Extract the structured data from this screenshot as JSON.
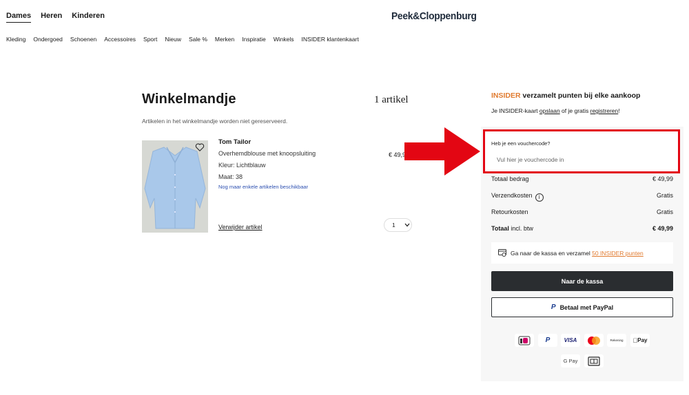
{
  "header": {
    "genders": [
      {
        "label": "Dames",
        "active": true
      },
      {
        "label": "Heren",
        "active": false
      },
      {
        "label": "Kinderen",
        "active": false
      }
    ],
    "logo": "Peek&Cloppenburg",
    "categories": [
      "Kleding",
      "Ondergoed",
      "Schoenen",
      "Accessoires",
      "Sport",
      "Nieuw",
      "Sale %",
      "Merken",
      "Inspiratie",
      "Winkels",
      "INSIDER klantenkaart"
    ]
  },
  "cart": {
    "title": "Winkelmandje",
    "count": "1 artikel",
    "note": "Artikelen in het winkelmandje worden niet gereserveerd."
  },
  "product": {
    "brand": "Tom Tailor",
    "description": "Overhemdblouse met knoopsluiting",
    "color": "Kleur: Lichtblauw",
    "size": "Maat: 38",
    "availability": "Nog maar enkele artikelen beschikbaar",
    "remove": "Verwijder artikel",
    "price": "€ 49,9",
    "quantity": "1"
  },
  "insider": {
    "brand": "INSIDER",
    "headline": " verzamelt punten bij elke aankoop",
    "sub_prefix": "Je INSIDER-kaart ",
    "sub_link1": "opslaan",
    "sub_mid": " of je gratis ",
    "sub_link2": "registreren",
    "sub_suffix": "!"
  },
  "voucher": {
    "label": "Heb je een vouchercode?",
    "placeholder": "Vul hier je vouchercode in"
  },
  "summary": {
    "total_label": "Totaal bedrag",
    "total_value": "€ 49,99",
    "shipping_label": "Verzendkosten",
    "shipping_value": "Gratis",
    "return_label": "Retourkosten",
    "return_value": "Gratis",
    "grand_label_bold": "Totaal",
    "grand_label_rest": " incl. btw",
    "grand_value": "€ 49,99"
  },
  "points": {
    "text": "Ga naar de kassa en verzamel ",
    "link": "50 INSIDER punten"
  },
  "buttons": {
    "checkout": "Naar de kassa",
    "paypal": "Betaal met PayPal"
  },
  "payment_methods": [
    "ideal-icon",
    "paypal-icon",
    "visa-icon",
    "mastercard-icon",
    "rekening-icon",
    "apple-pay-icon",
    "google-pay-icon",
    "giftcard-icon"
  ],
  "payment_labels": {
    "visa": "VISA",
    "rekening": "Rekening",
    "applepay": " Pay",
    "gpay": "G Pay"
  },
  "colors": {
    "accent_orange": "#e07a2e",
    "highlight_red": "#e30613",
    "button_dark": "#2a2d30",
    "link_blue": "#2c4fb0"
  }
}
